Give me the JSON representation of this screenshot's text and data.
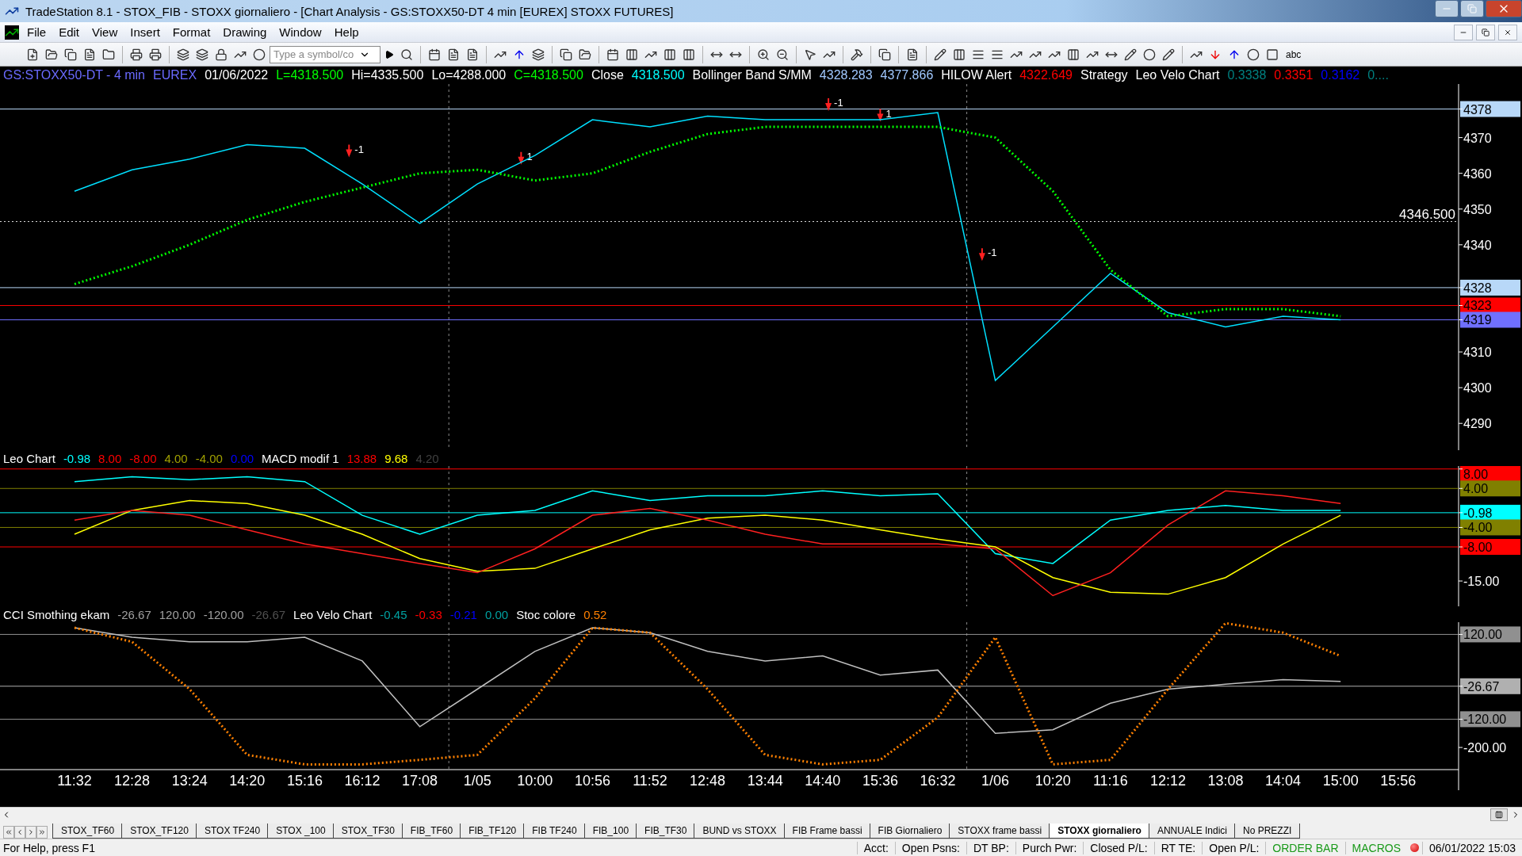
{
  "window": {
    "title": "TradeStation 8.1 - STOX_FIB - STOXX giornaliero - [Chart Analysis - GS:STOXX50-DT  4 min  [EUREX] STOXX FUTURES]"
  },
  "menu": [
    "File",
    "Edit",
    "View",
    "Insert",
    "Format",
    "Drawing",
    "Window",
    "Help"
  ],
  "toolbar": {
    "symbol_placeholder": "Type a symbol/co",
    "text_tool": "abc"
  },
  "price_pane": {
    "header": [
      {
        "text": "GS:STOXX50-DT - 4 min",
        "color": "#6a6aff"
      },
      {
        "text": "EUREX",
        "color": "#6a6aff"
      },
      {
        "text": "01/06/2022",
        "color": "#ffffff"
      },
      {
        "text": "L=4318.500",
        "color": "#00ff00"
      },
      {
        "text": "Hi=4335.500",
        "color": "#ffffff"
      },
      {
        "text": "Lo=4288.000",
        "color": "#ffffff"
      },
      {
        "text": "C=4318.500",
        "color": "#00ff00"
      },
      {
        "text": "Close",
        "color": "#ffffff"
      },
      {
        "text": "4318.500",
        "color": "#00ffff"
      },
      {
        "text": "Bollinger Band S/MM",
        "color": "#ffffff"
      },
      {
        "text": "4328.283",
        "color": "#a0c8ff"
      },
      {
        "text": "4377.866",
        "color": "#a0c8ff"
      },
      {
        "text": "HILOW Alert",
        "color": "#ffffff"
      },
      {
        "text": "4322.649",
        "color": "#ff0000"
      },
      {
        "text": "Strategy",
        "color": "#ffffff"
      },
      {
        "text": "Leo Velo Chart",
        "color": "#ffffff"
      },
      {
        "text": "0.3338",
        "color": "#008080"
      },
      {
        "text": "0.3351",
        "color": "#ff0000"
      },
      {
        "text": "0.3162",
        "color": "#0000ff"
      },
      {
        "text": "0....",
        "color": "#008080"
      }
    ],
    "chart_data": {
      "type": "line",
      "ylim": [
        4282.5,
        4385
      ],
      "yticks": [
        4290,
        4300,
        4310,
        {
          "value": 4319,
          "label": "4319"
        },
        {
          "value": 4323,
          "label": "4323"
        },
        {
          "value": 4328,
          "label": "4328"
        },
        4340,
        4350,
        4360,
        4370,
        {
          "value": 4378,
          "label": "4378"
        }
      ],
      "series": [
        {
          "color": "#00e0ff",
          "line_style": "solid",
          "values": [
            4355,
            4361,
            4364,
            4368,
            4367,
            4357,
            4346,
            4357,
            4365,
            4375,
            4373,
            4376,
            4375,
            4375,
            4375,
            4377,
            4302,
            4317,
            4332,
            4321,
            4317,
            4320,
            4319,
            null
          ]
        },
        {
          "color": "#00ff00",
          "line_style": "dotted",
          "values": [
            4329,
            4334,
            4340,
            4347,
            4352,
            4356,
            4360,
            4361,
            4358,
            4360,
            4366,
            4371,
            4373,
            4373,
            4373,
            4373,
            4370,
            4355,
            4333,
            4320,
            4322,
            4322,
            4320,
            null
          ]
        }
      ],
      "grid": true,
      "ref_lines": [
        {
          "axis": "y",
          "value": 4346.5,
          "label": "4346.500",
          "color": "#dddddd"
        },
        {
          "axis": "y",
          "value": 4378,
          "color": "#b8d8f8"
        },
        {
          "axis": "y",
          "value": 4328,
          "color": "#b8d8f8"
        },
        {
          "axis": "y",
          "value": 4323,
          "color": "#ff0000"
        },
        {
          "axis": "y",
          "value": 4319,
          "color": "#7070ff"
        }
      ],
      "annotations": [
        "-1",
        "1",
        "-1",
        "1",
        "-1"
      ]
    }
  },
  "macd_pane": {
    "header": [
      {
        "text": "Leo Chart",
        "color": "#ffffff"
      },
      {
        "text": "-0.98",
        "color": "#00ffff"
      },
      {
        "text": "8.00",
        "color": "#ff0000"
      },
      {
        "text": "-8.00",
        "color": "#ff0000"
      },
      {
        "text": "4.00",
        "color": "#a0a000"
      },
      {
        "text": "-4.00",
        "color": "#a0a000"
      },
      {
        "text": "0.00",
        "color": "#0000ff"
      },
      {
        "text": "MACD modif 1",
        "color": "#ffffff"
      },
      {
        "text": "13.88",
        "color": "#ff0000"
      },
      {
        "text": "9.68",
        "color": "#ffff00"
      },
      {
        "text": "4.20",
        "color": "#404040"
      }
    ],
    "chart_data": {
      "type": "line",
      "ylim": [
        -20.2,
        8.6
      ],
      "yticks": [
        {
          "value": 8,
          "label": "8.00"
        },
        {
          "value": 4,
          "label": "4.00"
        },
        {
          "value": -0.98,
          "label": "-0.98"
        },
        {
          "value": -4,
          "label": "-4.00"
        },
        {
          "value": -8,
          "label": "-8.00"
        },
        {
          "value": -15,
          "label": "-15.00"
        }
      ],
      "series": [
        {
          "color": "#00ffff",
          "line_style": "solid",
          "values": [
            5.4,
            6.4,
            5.8,
            6.4,
            5.4,
            -1.5,
            -5.4,
            -1.5,
            -0.5,
            3.5,
            1.5,
            2.5,
            2.5,
            3.5,
            2.5,
            2.9,
            -9.4,
            -11.4,
            -2.5,
            -0.5,
            0.5,
            -0.5,
            -0.5,
            null
          ]
        },
        {
          "color": "#ffff00",
          "line_style": "solid",
          "values": [
            -5.4,
            -0.5,
            1.5,
            0.9,
            -1.5,
            -5.4,
            -10.4,
            -13,
            -12.4,
            -8.4,
            -4.5,
            -2.1,
            -1.5,
            -2.5,
            -4.5,
            -6.4,
            -8,
            -14.3,
            -17.3,
            -17.7,
            -14.3,
            -7.4,
            -1.5,
            null
          ]
        },
        {
          "color": "#ff2020",
          "line_style": "solid",
          "values": [
            -2.5,
            -0.5,
            -1.5,
            -4.5,
            -7.4,
            -9.4,
            -11.4,
            -13.3,
            -8.4,
            -1.5,
            -0.1,
            -2.5,
            -5.4,
            -7.4,
            -7.4,
            -7.4,
            -8.4,
            -18,
            -13.3,
            -3.5,
            3.5,
            2.5,
            0.9,
            null
          ]
        }
      ],
      "grid": true,
      "ref_lines": [
        {
          "axis": "y",
          "value": 8,
          "color": "#ff0000"
        },
        {
          "axis": "y",
          "value": 4,
          "color": "#808000"
        },
        {
          "axis": "y",
          "value": -0.98,
          "color": "#00ffff"
        },
        {
          "axis": "y",
          "value": -4,
          "color": "#808000"
        },
        {
          "axis": "y",
          "value": -8,
          "color": "#ff0000"
        }
      ]
    }
  },
  "cci_pane": {
    "header": [
      {
        "text": "CCI Smothing ekam",
        "color": "#ffffff"
      },
      {
        "text": "-26.67",
        "color": "#a0a0a0"
      },
      {
        "text": "120.00",
        "color": "#a0a0a0"
      },
      {
        "text": "-120.00",
        "color": "#a0a0a0"
      },
      {
        "text": "-26.67",
        "color": "#505050"
      },
      {
        "text": "Leo Velo Chart",
        "color": "#ffffff"
      },
      {
        "text": "-0.45",
        "color": "#00a0a0"
      },
      {
        "text": "-0.33",
        "color": "#ff0000"
      },
      {
        "text": "-0.21",
        "color": "#0000ff"
      },
      {
        "text": "0.00",
        "color": "#00a0a0"
      },
      {
        "text": "Stoc colore",
        "color": "#ffffff"
      },
      {
        "text": "0.52",
        "color": "#ff8000"
      }
    ],
    "chart_data": {
      "type": "line",
      "categories": [
        "11:32",
        "12:28",
        "13:24",
        "14:20",
        "15:16",
        "16:12",
        "17:08",
        "1/05",
        "10:00",
        "10:56",
        "11:52",
        "12:48",
        "13:44",
        "14:40",
        "15:36",
        "16:32",
        "1/06",
        "10:20",
        "11:16",
        "12:12",
        "13:08",
        "14:04",
        "15:00",
        "15:56"
      ],
      "ylim": [
        -262.7,
        154.6
      ],
      "yticks": [
        {
          "value": 120,
          "label": "120.00"
        },
        {
          "value": -26.67,
          "label": "-26.67"
        },
        {
          "value": -120,
          "label": "-120.00"
        },
        {
          "value": -200,
          "label": "-200.00"
        }
      ],
      "series": [
        {
          "color": "#c0c0c0",
          "line_style": "solid",
          "values": [
            139,
            112,
            99,
            99,
            112,
            45,
            -141,
            -35,
            72,
            139,
            125,
            72,
            45,
            59,
            5,
            19,
            -160,
            -150,
            -75,
            -35,
            -21,
            -8,
            -13,
            null
          ]
        },
        {
          "color": "#ff8000",
          "line_style": "dotted",
          "values": [
            139,
            99,
            -35,
            -221,
            -248,
            -248,
            -235,
            -221,
            -61,
            139,
            125,
            -35,
            -221,
            -248,
            -235,
            -115,
            112,
            -248,
            -235,
            -35,
            152,
            125,
            59,
            null
          ]
        }
      ],
      "grid": true,
      "ref_lines": [
        {
          "axis": "y",
          "value": 120,
          "color": "#909090"
        },
        {
          "axis": "y",
          "value": -26.67,
          "color": "#b0b0b0"
        },
        {
          "axis": "y",
          "value": -120,
          "color": "#909090"
        }
      ]
    }
  },
  "tabs": [
    {
      "label": "STOX_TF60",
      "selected": false
    },
    {
      "label": "STOX_TF120",
      "selected": false
    },
    {
      "label": "STOX TF240",
      "selected": false
    },
    {
      "label": "STOX _100",
      "selected": false
    },
    {
      "label": "STOX_TF30",
      "selected": false
    },
    {
      "label": "FIB_TF60",
      "selected": false
    },
    {
      "label": "FIB_TF120",
      "selected": false
    },
    {
      "label": "FIB TF240",
      "selected": false
    },
    {
      "label": "FIB_100",
      "selected": false
    },
    {
      "label": "FIB_TF30",
      "selected": false
    },
    {
      "label": "BUND vs STOXX",
      "selected": false
    },
    {
      "label": "FIB Frame bassi",
      "selected": false
    },
    {
      "label": "FIB Giornaliero",
      "selected": false
    },
    {
      "label": "STOXX frame bassi",
      "selected": false
    },
    {
      "label": "STOXX giornaliero",
      "selected": true
    },
    {
      "label": "ANNUALE Indici",
      "selected": false
    },
    {
      "label": "No PREZZI",
      "selected": false
    }
  ],
  "status_bar": {
    "help": "For Help, press F1",
    "fields": [
      "Acct:",
      "Open Psns:",
      "DT BP:",
      "Purch Pwr:",
      "Closed P/L:",
      "RT TE:",
      "Open P/L:"
    ],
    "order_bar": "ORDER BAR",
    "macros": "MACROS",
    "datetime": "06/01/2022 15:03"
  }
}
